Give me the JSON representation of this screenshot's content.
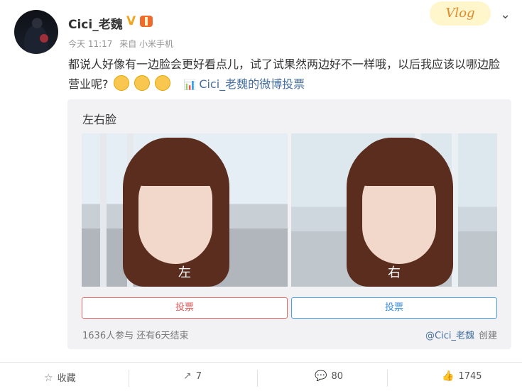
{
  "post": {
    "user_name": "Cici_老魏",
    "verified_mark": "V",
    "time": "今天 11:17",
    "source": "来自 小米手机",
    "content": "都说人好像有一边脸会更好看点儿，试了试果然两边好不一样哦，以后我应该以哪边脸营业呢?",
    "vote_link": "Cici_老魏的微博投票",
    "vlog_badge": "Vlog"
  },
  "vote": {
    "title": "左右脸",
    "options": [
      {
        "label": "左",
        "button": "投票"
      },
      {
        "label": "右",
        "button": "投票"
      }
    ],
    "stats": "1636人参与 还有6天结束",
    "creator_user": "@Cici_老魏",
    "creator_suffix": "创建"
  },
  "actions": {
    "collect": "收藏",
    "repost": "7",
    "comment": "80",
    "like": "1745"
  },
  "icons": {
    "collect": "star-icon",
    "repost": "share-icon",
    "comment": "comment-icon",
    "like": "thumbs-up-icon",
    "menu": "chevron-down-icon"
  },
  "colors": {
    "link": "#4670a1",
    "vote_left": "#e05a5a",
    "vote_right": "#3c8fdb",
    "verified": "#f2a51a"
  }
}
